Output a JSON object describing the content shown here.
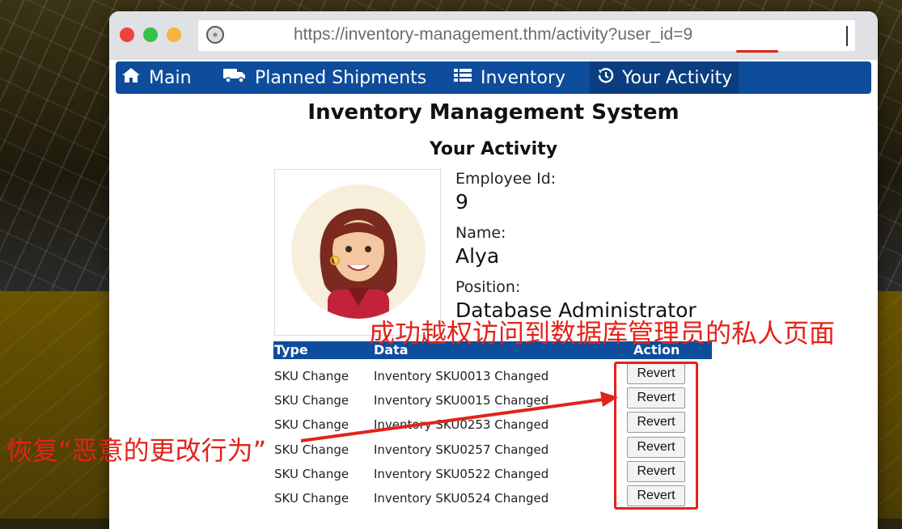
{
  "browser": {
    "url": "https://inventory-management.thm/activity?user_id=9"
  },
  "nav": {
    "items": [
      {
        "label": "Main",
        "icon": "home-icon"
      },
      {
        "label": "Planned Shipments",
        "icon": "truck-icon"
      },
      {
        "label": "Inventory",
        "icon": "list-icon"
      },
      {
        "label": "Your Activity",
        "icon": "history-icon",
        "active": true
      }
    ]
  },
  "page": {
    "title": "Inventory Management System",
    "section": "Your Activity"
  },
  "profile": {
    "employee_id_label": "Employee Id:",
    "employee_id": "9",
    "name_label": "Name:",
    "name": "Alya",
    "position_label": "Position:",
    "position": "Database Administrator"
  },
  "table": {
    "headers": {
      "type": "Type",
      "data": "Data",
      "action": "Action"
    },
    "rows": [
      {
        "type": "SKU Change",
        "data": "Inventory SKU0013 Changed",
        "action": "Revert"
      },
      {
        "type": "SKU Change",
        "data": "Inventory SKU0015 Changed",
        "action": "Revert"
      },
      {
        "type": "SKU Change",
        "data": "Inventory SKU0253 Changed",
        "action": "Revert"
      },
      {
        "type": "SKU Change",
        "data": "Inventory SKU0257 Changed",
        "action": "Revert"
      },
      {
        "type": "SKU Change",
        "data": "Inventory SKU0522 Changed",
        "action": "Revert"
      },
      {
        "type": "SKU Change",
        "data": "Inventory SKU0524 Changed",
        "action": "Revert"
      }
    ]
  },
  "annotations": {
    "top": "成功越权访问到数据库管理员的私人页面",
    "left": "恢复“恶意的更改行为”"
  },
  "colors": {
    "nav_bg": "#0e4c9c",
    "annotation_red": "#e2231a"
  }
}
